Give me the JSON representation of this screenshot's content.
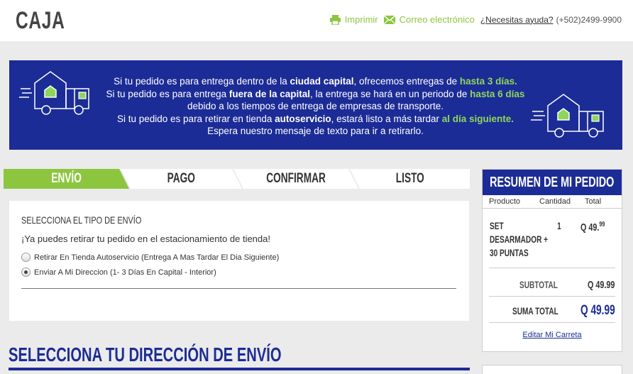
{
  "header": {
    "logo": "CAJA",
    "print_label": "Imprimir",
    "email_label": "Correo electrónico",
    "help_label": "¿Necesitas ayuda?",
    "phone": "(+502)2499-9900"
  },
  "banner": {
    "line1_a": "Si tu pedido es para entrega dentro de la ",
    "line1_b": "ciudad capital",
    "line1_c": ", ofrecemos entregas de ",
    "line1_d": "hasta 3 días.",
    "line2_a": "Si tu pedido es para entrega ",
    "line2_b": "fuera de la capital",
    "line2_c": ", la entrega se hará en un periodo de ",
    "line2_d": "hasta 6 días",
    "line3": "debido a los tiempos de entrega de empresas de transporte.",
    "line4_a": "Si tu pedido es para retirar en tienda ",
    "line4_b": "autoservicio",
    "line4_c": ", estará listo a más tardar ",
    "line4_d": "al día siguiente.",
    "line5": "Espera nuestro mensaje de texto para ir a retirarlo."
  },
  "steps": [
    "ENVÍO",
    "PAGO",
    "CONFIRMAR",
    "LISTO"
  ],
  "shipping": {
    "title": "SELECCIONA EL TIPO DE ENVÍO",
    "message": "¡Ya puedes retirar tu pedido en el estacionamiento de tienda!",
    "options": [
      "Retirar En Tienda Autoservicio (Entrega A Mas Tardar El Dia Siguiente)",
      "Enviar A Mi Direccion (1- 3 Días En Capital - Interior)"
    ],
    "selected_index": 1
  },
  "address_title": "SELECCIONA TU DIRECCIÓN DE ENVÍO",
  "summary": {
    "title": "RESUMEN DE MI PEDIDO",
    "col_product": "Producto",
    "col_qty": "Cantidad",
    "col_total": "Total",
    "item_line1": "SET",
    "item_line2": "DESARMADOR +",
    "item_line3": "30 PUNTAS",
    "item_qty": "1",
    "item_price": "Q 49.",
    "item_cents": "99",
    "subtotal_label": "SUBTOTAL",
    "subtotal_value": "Q 49.99",
    "total_label": "SUMA TOTAL",
    "total_value": "Q 49.99",
    "edit_link": "Editar Mi Carreta"
  },
  "colors": {
    "brand_blue": "#1c2c96",
    "accent_green": "#8cc63f",
    "banner_green": "#8ed65b"
  }
}
